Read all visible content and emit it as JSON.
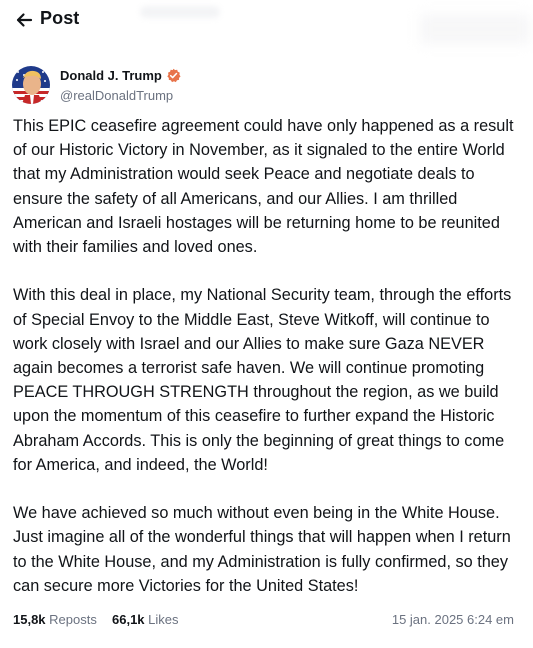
{
  "header": {
    "title": "Post",
    "back_icon": "arrow-left-icon"
  },
  "author": {
    "display_name": "Donald J. Trump",
    "handle": "@realDonaldTrump",
    "verified_icon": "verified-badge-icon",
    "verified_color": "#e8734a"
  },
  "post": {
    "paragraphs": [
      "This EPIC ceasefire agreement could have only happened as a result of our Historic Victory in November, as it signaled to the entire World that my Administration would seek Peace and negotiate deals to ensure the safety of all Americans, and our Allies. I am thrilled American and Israeli hostages will be returning home to be reunited with their families and loved ones.",
      "With this deal in place, my National Security team, through the efforts of Special Envoy to the Middle East, Steve Witkoff, will continue to work closely with Israel and our Allies to make sure Gaza NEVER again becomes a terrorist safe haven. We will continue promoting PEACE THROUGH STRENGTH throughout the region, as we build upon the momentum of this ceasefire to further expand the Historic Abraham Accords. This is only the beginning of great things to come for America, and indeed, the World!",
      "We have achieved so much without even being in the White House. Just imagine all of the wonderful things that will happen when I return to the White House, and my Administration is fully confirmed, so they can secure more Victories for the United States!"
    ]
  },
  "stats": {
    "reposts_count": "15,8k",
    "reposts_label": "Reposts",
    "likes_count": "66,1k",
    "likes_label": "Likes",
    "timestamp": "15 jan. 2025 6:24 em"
  }
}
